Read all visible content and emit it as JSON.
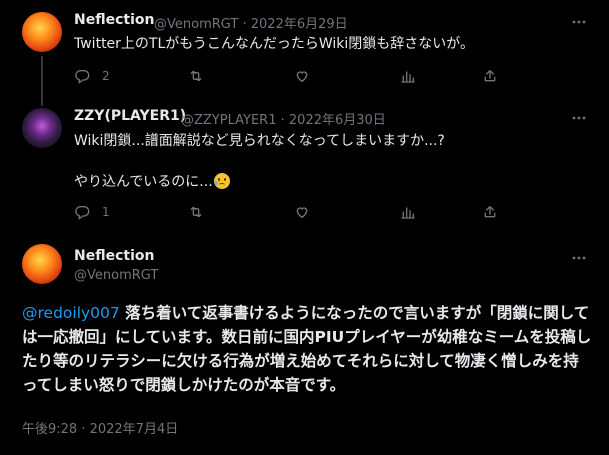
{
  "tweets": [
    {
      "name": "Neflection",
      "handle": "@VenomRGT",
      "separator": "·",
      "date": "2022年6月29日",
      "text": "Twitter上のTLがもうこんなんだったらWiki閉鎖も辞さないが。",
      "reply_count": "2",
      "retweet_count": "",
      "like_count": ""
    },
    {
      "name": "ZZY(PLAYER1)",
      "handle": "@ZZYPLAYER1",
      "separator": "·",
      "date": "2022年6月30日",
      "text_line1": "Wiki閉鎖...譜面解説など見られなくなってしまいますか...?",
      "text_line2": "やり込んでいるのに...",
      "reply_count": "1",
      "retweet_count": "",
      "like_count": ""
    }
  ],
  "main_tweet": {
    "name": "Neflection",
    "handle": "@VenomRGT",
    "mention": "@redoily007",
    "text": " 落ち着いて返事書けるようになったので言いますが「閉鎖に関しては一応撤回」にしています。数日前に国内PIUプレイヤーが幼稚なミームを投稿したり等のリテラシーに欠ける行為が増え始めてそれらに対して物凄く憎しみを持ってしまい怒りで閉鎖しかけたのが本音です。",
    "timestamp": "午後9:28 · 2022年7月4日"
  },
  "icons": {
    "more": "more-dots-icon",
    "reply": "reply-icon",
    "retweet": "retweet-icon",
    "like": "heart-icon",
    "analytics": "analytics-icon",
    "share": "share-icon",
    "emoji": "sad-tear-face-emoji"
  },
  "colors": {
    "background": "#000000",
    "text": "#e7e9ea",
    "secondary": "#71767b",
    "link": "#1d9bf0",
    "thread_line": "#333639"
  }
}
